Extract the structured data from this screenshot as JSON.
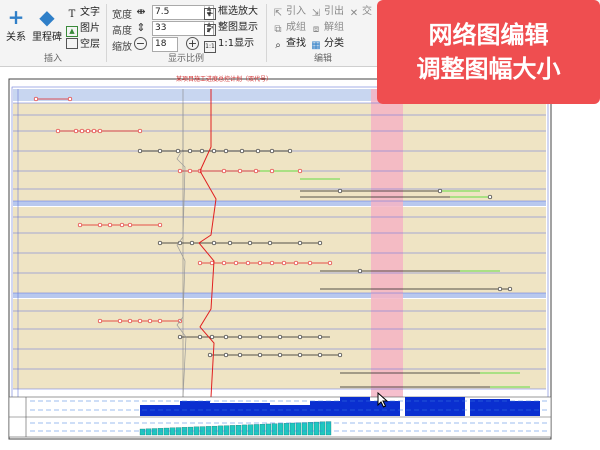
{
  "ribbon": {
    "insert": {
      "title": "插入",
      "relation_label": "关系",
      "milestone_label": "里程碑",
      "text_label": "文字",
      "image_label": "图片",
      "empty_layer_label": "空层"
    },
    "scale": {
      "title": "显示比例",
      "width_label": "宽度",
      "width_value": "7.5",
      "height_label": "高度",
      "height_value": "33",
      "zoom_label": "缩放",
      "zoom_value": "18",
      "box_zoom_label": "框选放大",
      "fit_label": "整图显示",
      "one_to_one_label": "1:1显示"
    },
    "edit": {
      "title": "编辑",
      "import_label": "引入",
      "export_label": "引出",
      "cross_label": "交",
      "group_label": "成组",
      "ungroup_label": "解组",
      "find_label": "查找",
      "classify_label": "分类"
    }
  },
  "chart": {
    "title": "某项目施工进度总控计划（双代号）"
  },
  "banner": {
    "line1": "网络图编辑",
    "line2": "调整图幅大小"
  },
  "colors": {
    "banner_bg": "#ef4e50",
    "band_bg": "#efe4c4",
    "highlight_column": "#f4b4c4",
    "critical_path": "#e02020",
    "float_line": "#66dd44",
    "resource_bar": "#0a2fd0",
    "resource_bar2": "#1fc8c0",
    "grid_line": "#5a6ee0"
  }
}
